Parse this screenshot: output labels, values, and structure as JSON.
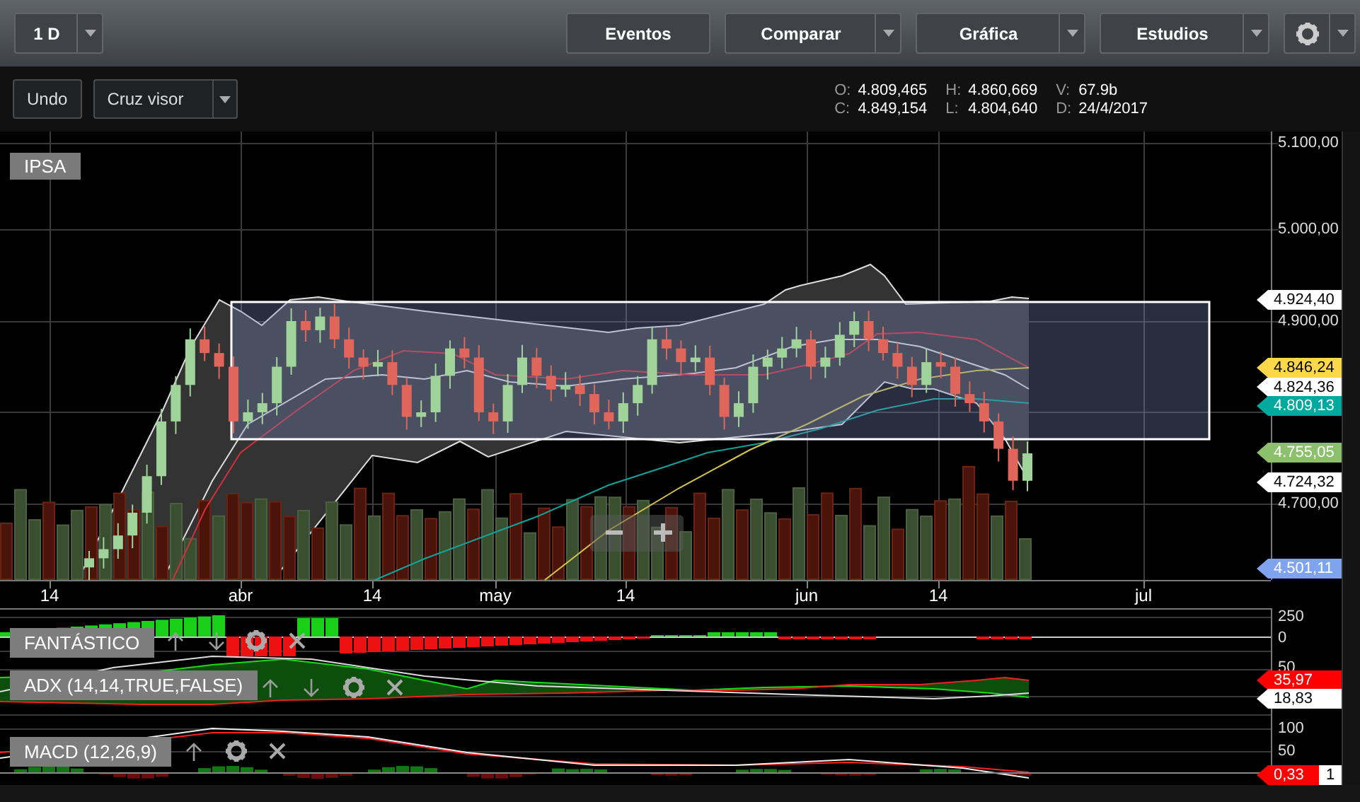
{
  "toolbar": {
    "period": "1 D",
    "buttons": [
      {
        "label": "Eventos",
        "dropdown": false
      },
      {
        "label": "Comparar",
        "dropdown": true
      },
      {
        "label": "Gráfica",
        "dropdown": true
      },
      {
        "label": "Estudios",
        "dropdown": true
      }
    ]
  },
  "controls": {
    "undo": "Undo",
    "crosshair": "Cruz visor"
  },
  "quote": [
    {
      "label": "O:",
      "value": "4.809,465"
    },
    {
      "label": "H:",
      "value": "4.860,669"
    },
    {
      "label": "V:",
      "value": "67.9b"
    },
    {
      "label": "C:",
      "value": "4.849,154"
    },
    {
      "label": "L:",
      "value": "4.804,640"
    },
    {
      "label": "D:",
      "value": "24/4/2017"
    }
  ],
  "chart": {
    "symbol": "IPSA",
    "price_ticks": [
      "5.100,00",
      "5.000,00",
      "4.900,00",
      "4.700,00"
    ],
    "price_tags": [
      {
        "value": "4.924,40",
        "color": "#ffffff"
      },
      {
        "value": "4.846,24",
        "color": "#ffd84a"
      },
      {
        "value": "4.824,36",
        "color": "#ffffff"
      },
      {
        "value": "4.809,13",
        "color": "#00a99d"
      },
      {
        "value": "4.755,05",
        "color": "#8cc06c"
      },
      {
        "value": "4.724,32",
        "color": "#ffffff"
      },
      {
        "value": "4.501,11",
        "color": "#7fa3ef"
      }
    ],
    "x_labels": [
      "14",
      "abr",
      "14",
      "may",
      "14",
      "jun",
      "14",
      "jul"
    ]
  },
  "indicators": [
    {
      "kind": "histogram",
      "title": "FANTÁSTICO",
      "move_down": true,
      "axis_ticks": [
        "250",
        "0"
      ]
    },
    {
      "kind": "adx",
      "title": "ADX (14,14,TRUE,FALSE)",
      "move_down": true,
      "axis_ticks": [
        "50"
      ],
      "tags": [
        {
          "value": "35,97",
          "color": "#ff0000"
        },
        {
          "value": "18,83",
          "color": "#ffffff"
        }
      ]
    },
    {
      "kind": "macd",
      "title": "MACD (12,26,9)",
      "move_down": false,
      "axis_ticks": [
        "100",
        "50"
      ],
      "tags": [
        {
          "value": "0,33",
          "color": "#ff0000"
        },
        {
          "value": "1",
          "color": "#ffffff"
        }
      ]
    }
  ]
}
